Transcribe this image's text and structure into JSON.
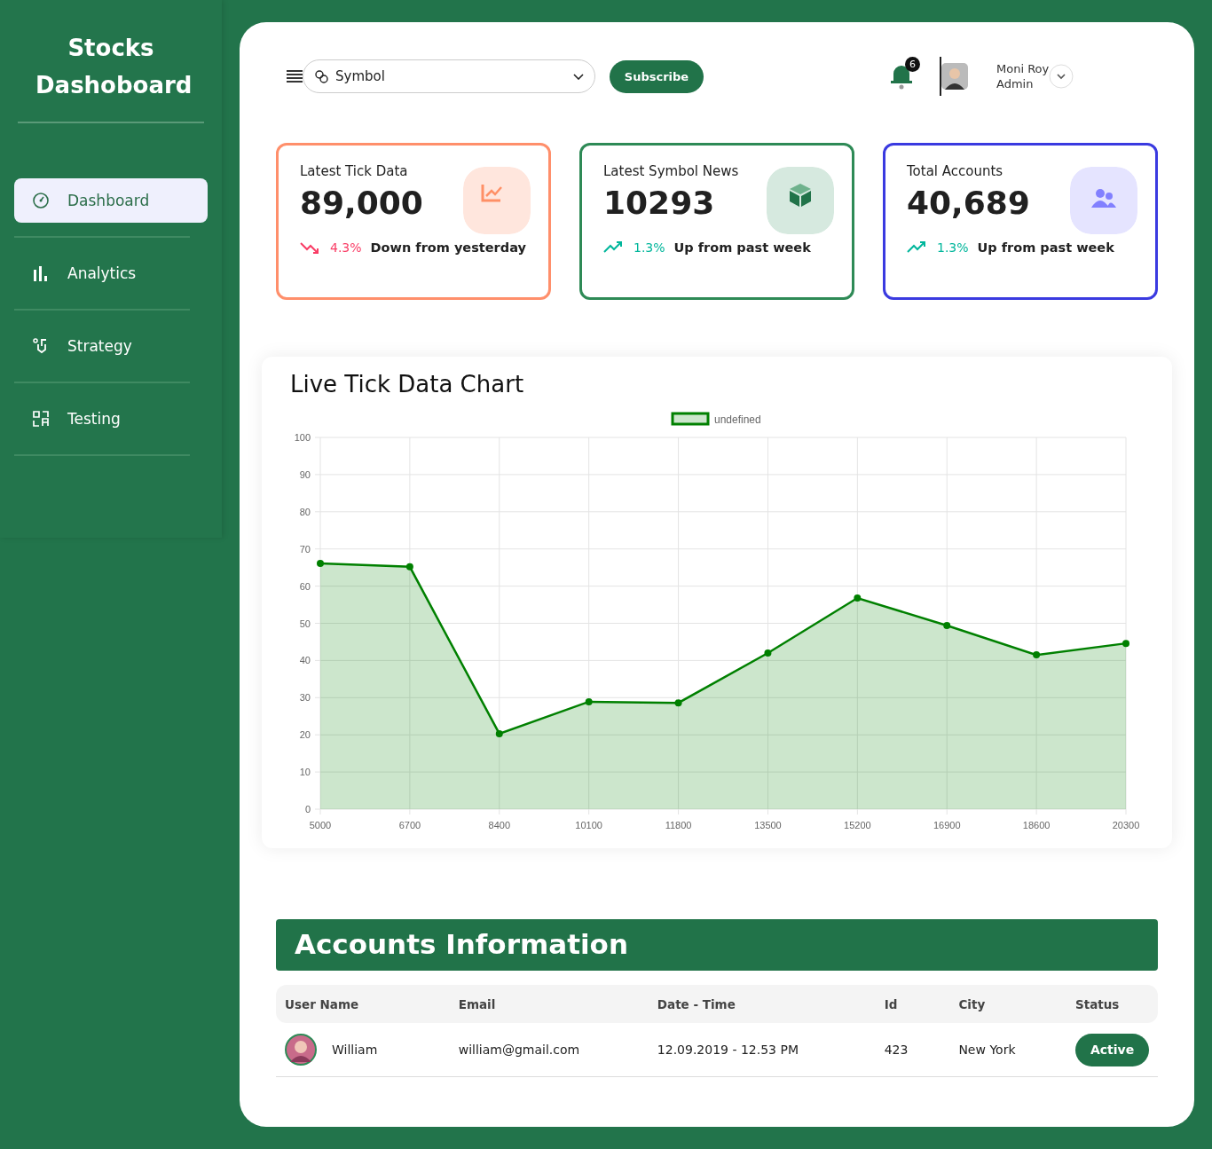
{
  "sidebar": {
    "title": "Stocks Dashoboard",
    "items": [
      {
        "label": "Dashboard",
        "selected": true
      },
      {
        "label": "Analytics",
        "selected": false
      },
      {
        "label": "Strategy",
        "selected": false
      },
      {
        "label": "Testing",
        "selected": false
      }
    ]
  },
  "topbar": {
    "symbol_select": {
      "placeholder": "Symbol"
    },
    "subscribe": "Subscribe",
    "notifications": "6",
    "user": {
      "name": "Moni Roy",
      "role": "Admin"
    }
  },
  "stats": [
    {
      "title": "Latest Tick Data",
      "value": "89,000",
      "change": "4.3%",
      "rising": false,
      "note": "Down from yesterday",
      "color": "#ff8f6b"
    },
    {
      "title": "Latest Symbol News",
      "value": "10293",
      "change": "1.3%",
      "rising": true,
      "note": "Up from past week",
      "color": "#2e8a56"
    },
    {
      "title": "Total Accounts",
      "value": "40,689",
      "change": "1.3%",
      "rising": true,
      "note": "Up from past week",
      "color": "#3a3ae0"
    }
  ],
  "chart": {
    "title": "Live Tick Data Chart",
    "chart_data": {
      "type": "area",
      "categories": [
        "5000",
        "6700",
        "8400",
        "10100",
        "11800",
        "13500",
        "15200",
        "16900",
        "18600",
        "20300"
      ],
      "series": [
        {
          "name": "undefined",
          "color": "#008000",
          "values": [
            66.1,
            65.2,
            20.3,
            28.9,
            28.6,
            42.0,
            56.8,
            49.4,
            41.5,
            44.6
          ]
        }
      ],
      "ylim": [
        0,
        100
      ],
      "grid": true,
      "yticks": [
        0,
        10,
        20,
        30,
        40,
        50,
        60,
        70,
        80,
        90,
        100
      ]
    }
  },
  "accounts": {
    "title": "Accounts Information",
    "columns": [
      "User Name",
      "Email",
      "Date - Time",
      "Id",
      "City",
      "Status"
    ],
    "rows": [
      {
        "user": "William",
        "email": "william@gmail.com",
        "datetime": "12.09.2019 - 12.53 PM",
        "id": "423",
        "city": "New York",
        "status": "Active"
      }
    ]
  }
}
